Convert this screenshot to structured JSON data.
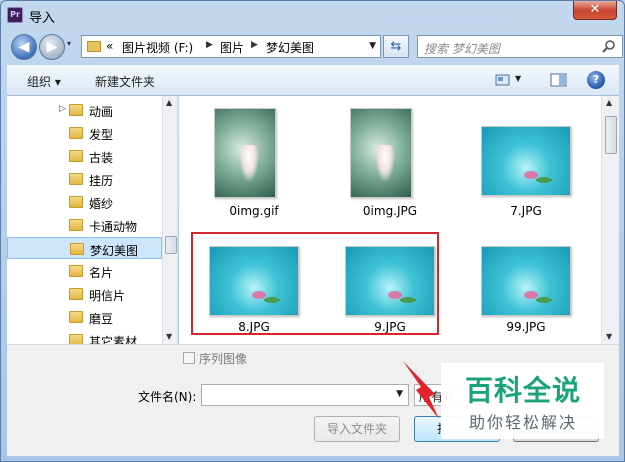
{
  "window": {
    "app_icon": "Pr",
    "title": "导入",
    "close_label": "✕"
  },
  "address_bar": {
    "overflow_label": "«",
    "crumbs": [
      "图片视频 (F:)",
      "图片",
      "梦幻美图"
    ]
  },
  "search": {
    "placeholder": "搜索 梦幻美图"
  },
  "toolbar": {
    "organize_label": "组织 ▾",
    "new_folder_label": "新建文件夹",
    "help_label": "?"
  },
  "nav": {
    "items": [
      {
        "label": "动画",
        "selected": false,
        "expander": "▷"
      },
      {
        "label": "发型",
        "selected": false
      },
      {
        "label": "古装",
        "selected": false
      },
      {
        "label": "挂历",
        "selected": false
      },
      {
        "label": "婚纱",
        "selected": false
      },
      {
        "label": "卡通动物",
        "selected": false
      },
      {
        "label": "梦幻美图",
        "selected": true
      },
      {
        "label": "名片",
        "selected": false
      },
      {
        "label": "明信片",
        "selected": false
      },
      {
        "label": "磨豆",
        "selected": false
      },
      {
        "label": "其它素材",
        "selected": false
      }
    ]
  },
  "files": [
    {
      "name": "0img.gif",
      "kind": "portrait"
    },
    {
      "name": "0img.JPG",
      "kind": "portrait"
    },
    {
      "name": "7.JPG",
      "kind": "landscape"
    },
    {
      "name": "8.JPG",
      "kind": "landscape"
    },
    {
      "name": "9.JPG",
      "kind": "landscape"
    },
    {
      "name": "99.JPG",
      "kind": "landscape"
    }
  ],
  "bottom": {
    "sequence_label": "序列图像",
    "filename_label": "文件名(N):",
    "filename_value": "",
    "filter_text": "所有可",
    "import_folder_label": "导入文件夹",
    "open_label": "打"
  },
  "watermark": {
    "title": "百科全说",
    "subtitle": "助你轻松解决"
  },
  "colors": {
    "accent": "#3e70b8",
    "selection": "#cde5fb",
    "highlight_box": "#d4252b",
    "watermark_green": "#1aa37b"
  }
}
